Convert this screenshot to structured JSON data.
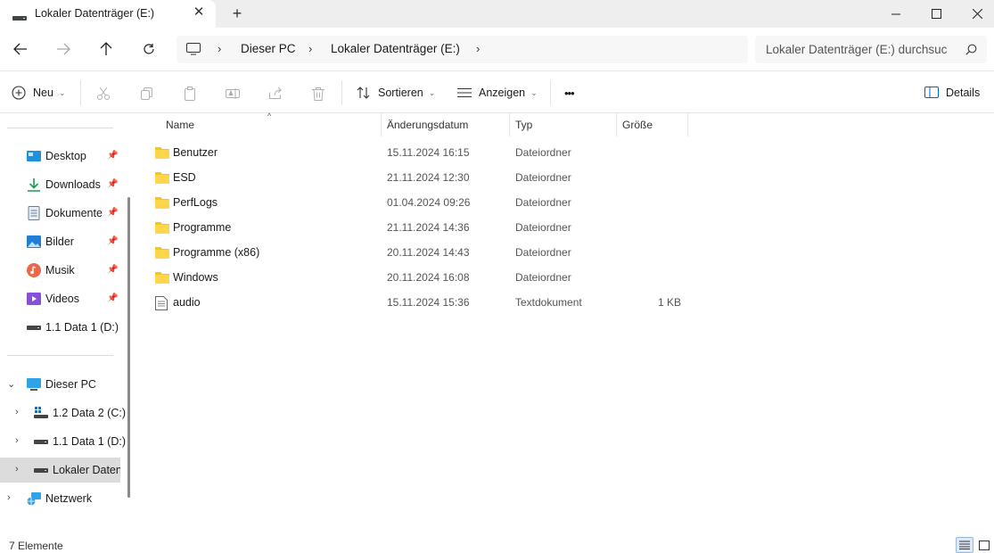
{
  "tab": {
    "title": "Lokaler Datenträger (E:)"
  },
  "address": {
    "crumbs": [
      "Dieser PC",
      "Lokaler Datenträger (E:)"
    ],
    "search_placeholder": "Lokaler Datenträger (E:) durchsuc"
  },
  "toolbar": {
    "new_label": "Neu",
    "sort_label": "Sortieren",
    "view_label": "Anzeigen",
    "more_label": "•••",
    "details_label": "Details"
  },
  "sidebar": {
    "quick_access": [
      {
        "label": "Desktop",
        "icon": "desktop-icon"
      },
      {
        "label": "Downloads",
        "icon": "downloads-icon"
      },
      {
        "label": "Dokumente",
        "icon": "documents-icon"
      },
      {
        "label": "Bilder",
        "icon": "pictures-icon"
      },
      {
        "label": "Musik",
        "icon": "music-icon"
      },
      {
        "label": "Videos",
        "icon": "videos-icon"
      },
      {
        "label": "1.1 Data 1 (D:)",
        "icon": "drive-icon"
      }
    ],
    "this_pc": {
      "label": "Dieser PC"
    },
    "drives": [
      {
        "label": "1.2 Data 2 (C:)"
      },
      {
        "label": "1.1 Data 1 (D:)"
      },
      {
        "label": "Lokaler Datent"
      }
    ],
    "network": {
      "label": "Netzwerk"
    }
  },
  "columns": {
    "name": "Name",
    "date": "Änderungsdatum",
    "type": "Typ",
    "size": "Größe"
  },
  "files": [
    {
      "name": "Benutzer",
      "date": "15.11.2024 16:15",
      "type": "Dateiordner",
      "size": "",
      "icon": "folder-icon"
    },
    {
      "name": "ESD",
      "date": "21.11.2024 12:30",
      "type": "Dateiordner",
      "size": "",
      "icon": "folder-icon"
    },
    {
      "name": "PerfLogs",
      "date": "01.04.2024 09:26",
      "type": "Dateiordner",
      "size": "",
      "icon": "folder-icon"
    },
    {
      "name": "Programme",
      "date": "21.11.2024 14:36",
      "type": "Dateiordner",
      "size": "",
      "icon": "folder-icon"
    },
    {
      "name": "Programme (x86)",
      "date": "20.11.2024 14:43",
      "type": "Dateiordner",
      "size": "",
      "icon": "folder-icon"
    },
    {
      "name": "Windows",
      "date": "20.11.2024 16:08",
      "type": "Dateiordner",
      "size": "",
      "icon": "folder-icon"
    },
    {
      "name": "audio",
      "date": "15.11.2024 15:36",
      "type": "Textdokument",
      "size": "1 KB",
      "icon": "text-file-icon"
    }
  ],
  "status": {
    "count": "7 Elemente"
  },
  "colors": {
    "folder": "#f5c518",
    "selected": "#dcdcdc",
    "accent": "#0067c0"
  }
}
